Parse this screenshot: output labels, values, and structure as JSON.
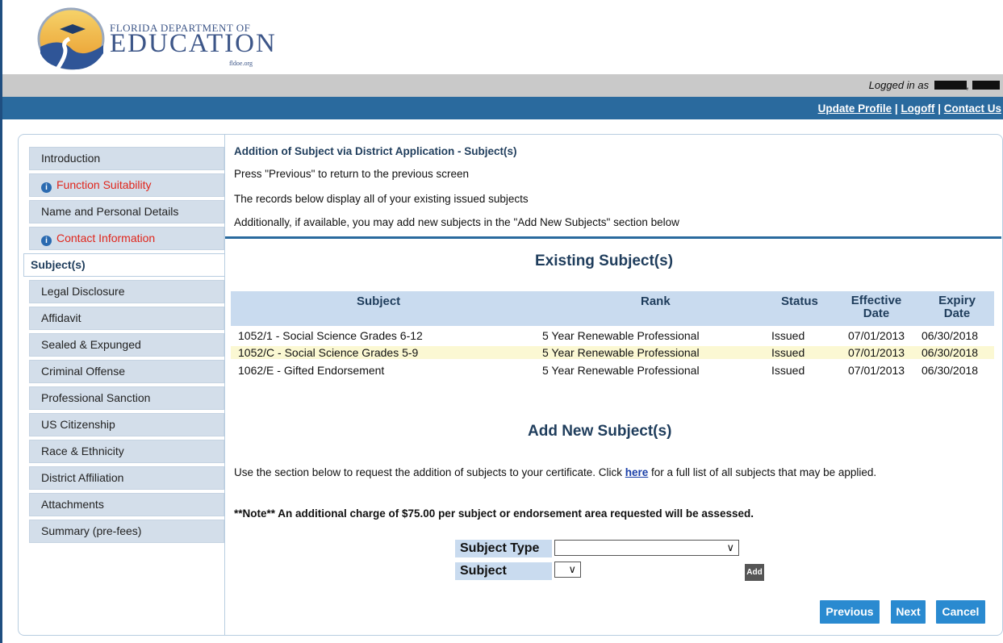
{
  "brand": {
    "line1": "FLORIDA DEPARTMENT OF",
    "line2": "EDUCATION",
    "site": "fldoe.org"
  },
  "header": {
    "logged_in_label": "Logged in as",
    "name_separator": ",",
    "links": [
      "Update Profile",
      "Logoff",
      "Contact Us"
    ],
    "link_separator": "|"
  },
  "nav": {
    "items": [
      {
        "label": "Introduction",
        "state": "normal"
      },
      {
        "label": "Function Suitability",
        "state": "warning",
        "icon": "info-icon"
      },
      {
        "label": "Name and Personal Details",
        "state": "normal"
      },
      {
        "label": "Contact Information",
        "state": "warning",
        "icon": "info-icon"
      },
      {
        "label": "Subject(s)",
        "state": "active"
      },
      {
        "label": "Legal Disclosure",
        "state": "normal"
      },
      {
        "label": "Affidavit",
        "state": "normal"
      },
      {
        "label": "Sealed & Expunged",
        "state": "normal"
      },
      {
        "label": "Criminal Offense",
        "state": "normal"
      },
      {
        "label": "Professional Sanction",
        "state": "normal"
      },
      {
        "label": "US Citizenship",
        "state": "normal"
      },
      {
        "label": "Race & Ethnicity",
        "state": "normal"
      },
      {
        "label": "District Affiliation",
        "state": "normal"
      },
      {
        "label": "Attachments",
        "state": "normal"
      },
      {
        "label": "Summary (pre-fees)",
        "state": "normal"
      }
    ]
  },
  "main": {
    "title": "Addition of Subject via District Application - Subject(s)",
    "lines": [
      "Press \"Previous\" to return to the previous screen",
      "The records below display all of your existing issued subjects",
      "Additionally, if available, you may add new subjects in the \"Add New Subjects\" section below"
    ],
    "existing": {
      "heading": "Existing Subject(s)",
      "columns": {
        "subject": "Subject",
        "rank": "Rank",
        "status": "Status",
        "effective_1": "Effective",
        "effective_2": "Date",
        "expiry_1": "Expiry",
        "expiry_2": "Date"
      },
      "rows": [
        {
          "subject": "1052/1 - Social Science Grades 6-12",
          "rank": "5 Year Renewable Professional",
          "status": "Issued",
          "effective": "07/01/2013",
          "expiry": "06/30/2018"
        },
        {
          "subject": "1052/C - Social Science Grades 5-9",
          "rank": "5 Year Renewable Professional",
          "status": "Issued",
          "effective": "07/01/2013",
          "expiry": "06/30/2018"
        },
        {
          "subject": "1062/E - Gifted Endorsement",
          "rank": "5 Year Renewable Professional",
          "status": "Issued",
          "effective": "07/01/2013",
          "expiry": "06/30/2018"
        }
      ]
    },
    "add_new": {
      "heading": "Add New Subject(s)",
      "instr_before": "Use the section below to request the addition of subjects to your certificate. Click ",
      "instr_link": "here",
      "instr_after": " for a full list of all subjects that may be applied.",
      "note": "**Note** An additional charge of $75.00 per subject or endorsement area requested will be assessed.",
      "subject_type_label": "Subject Type",
      "subject_type_value": "",
      "subject_label": "Subject",
      "subject_value": "",
      "add_label": "Add"
    },
    "buttons": {
      "previous": "Previous",
      "next": "Next",
      "cancel": "Cancel"
    }
  },
  "colors": {
    "header_blue": "#2a6a9e",
    "gray_bar": "#c9c9c9",
    "table_head": "#c9dbef",
    "alt_row": "#fbf8d3",
    "warn_text": "#e0251b",
    "button_blue": "#2a8ad0"
  }
}
